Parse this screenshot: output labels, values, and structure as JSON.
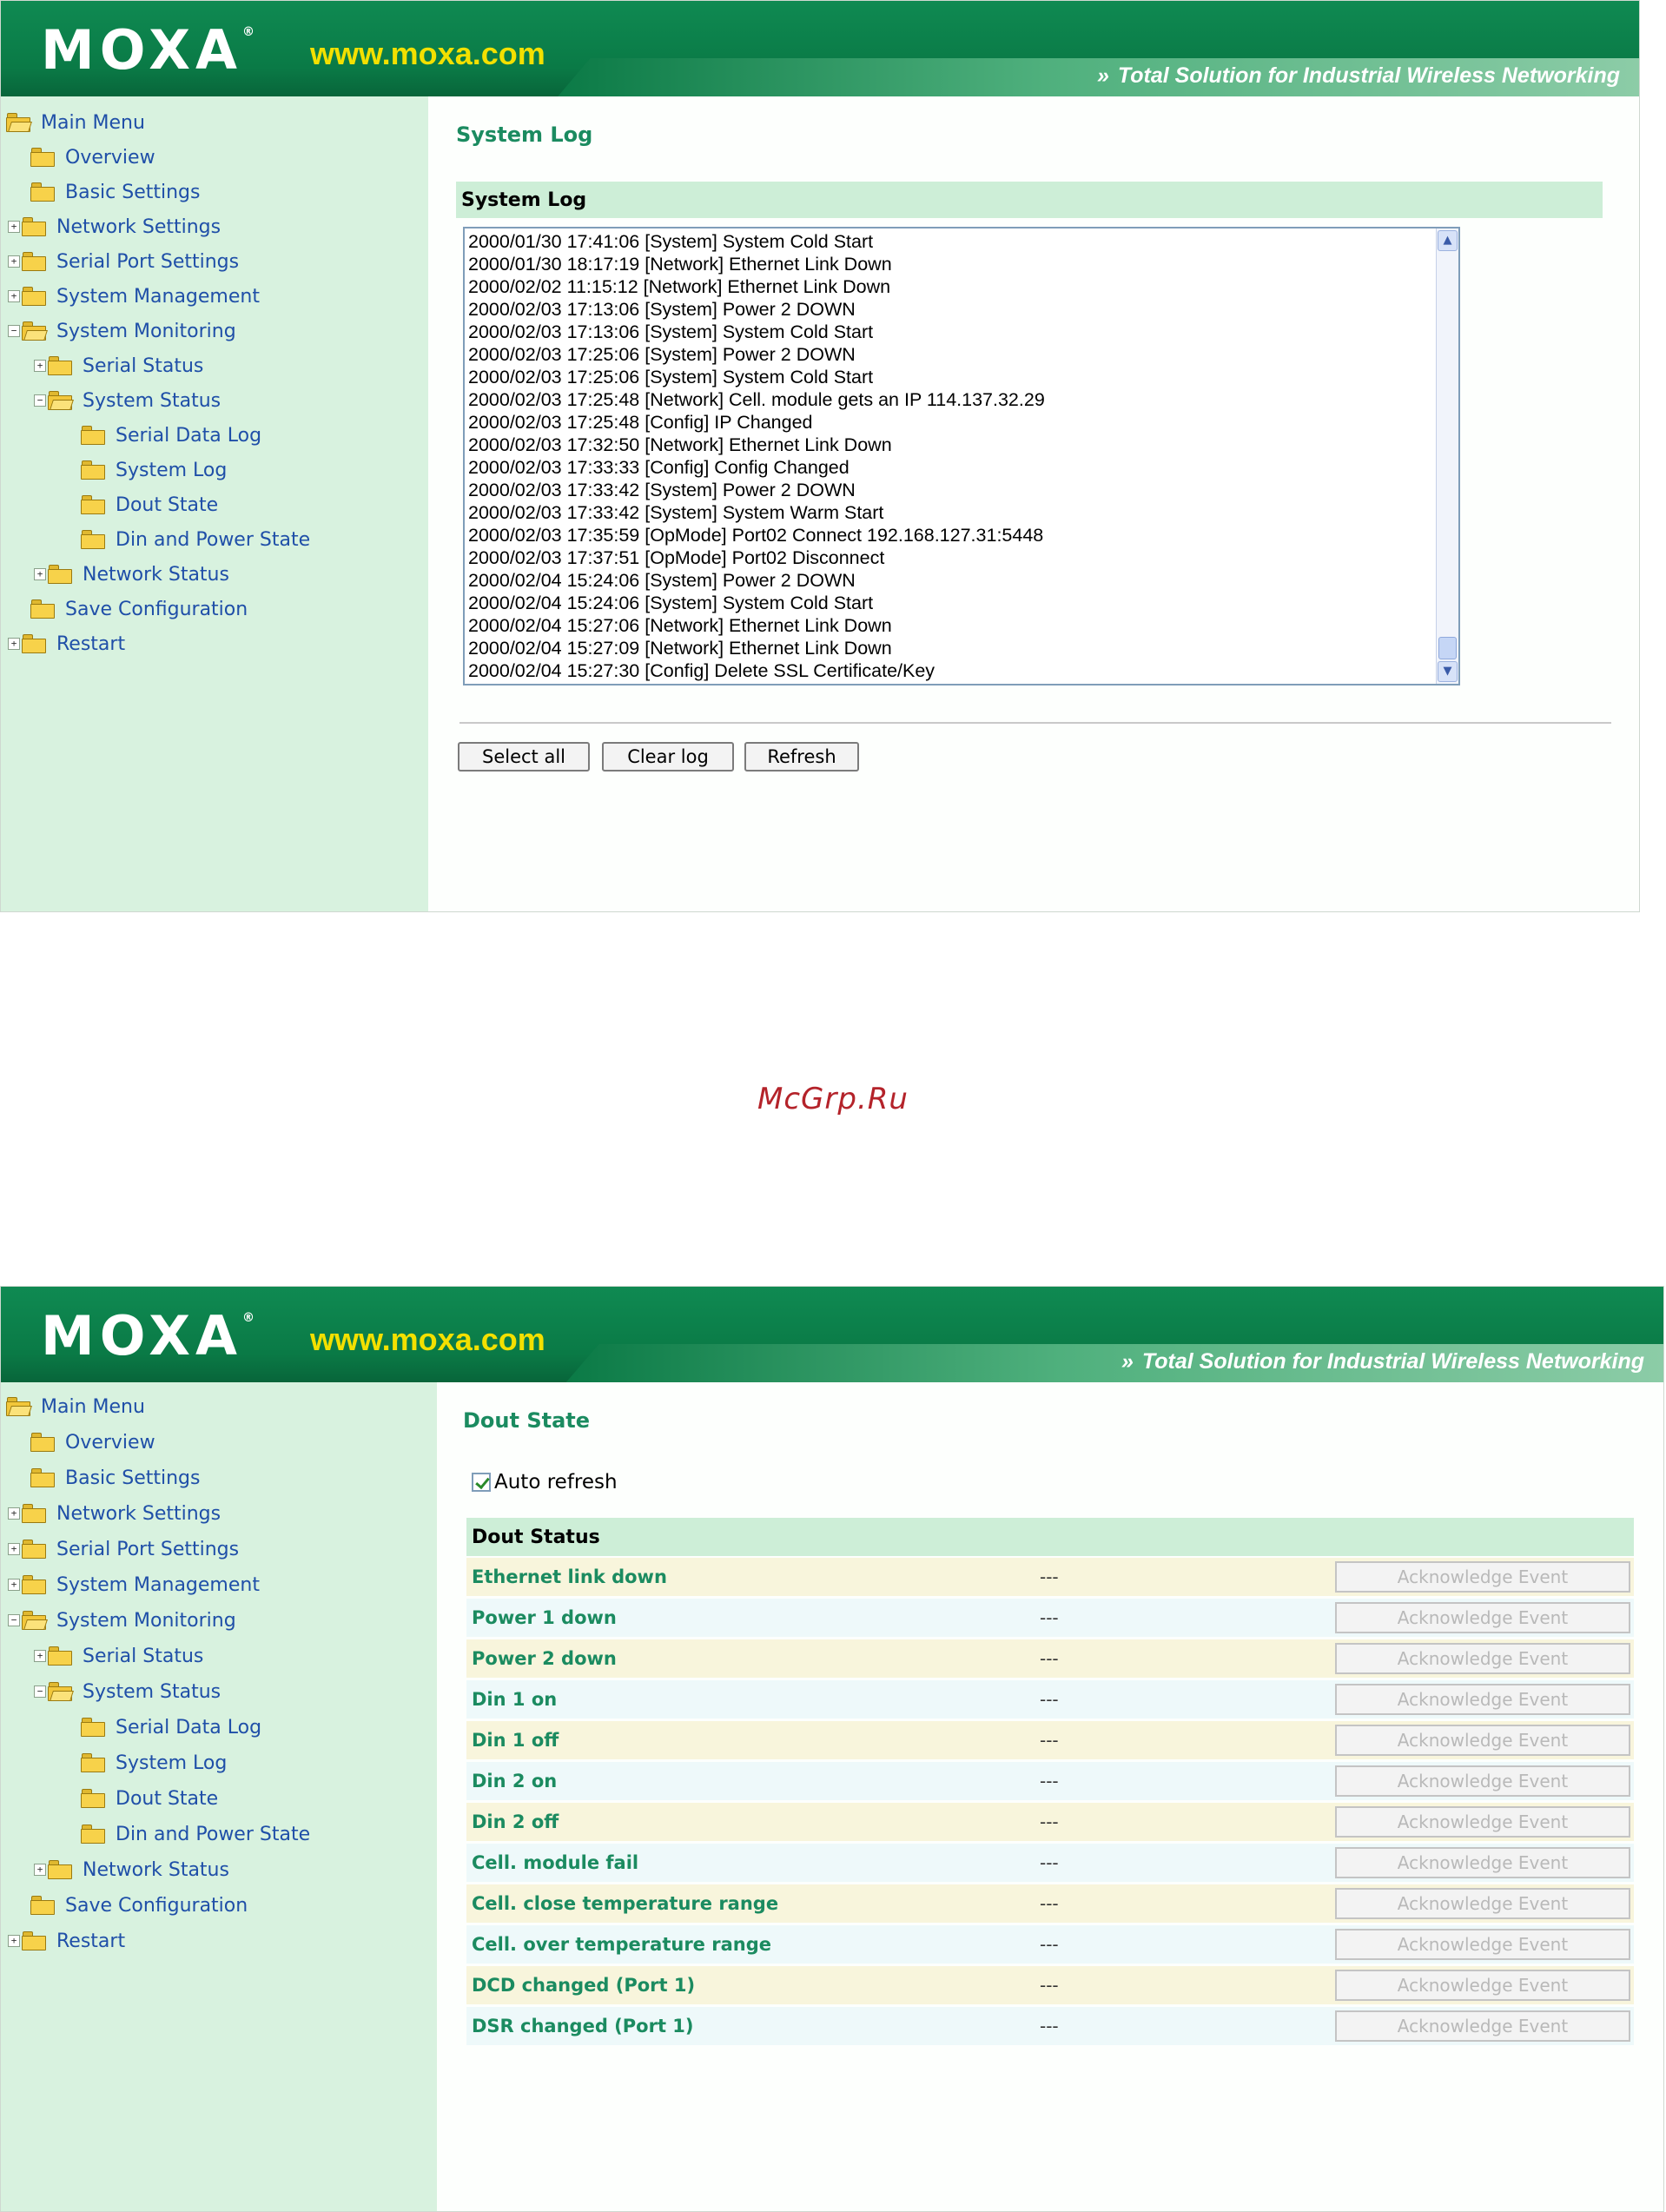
{
  "header": {
    "logo_text": "MOXA",
    "logo_mark": "®",
    "site": "www.moxa.com",
    "tagline_arrows": "»",
    "tagline": "Total Solution for Industrial Wireless Networking"
  },
  "menu": {
    "items": [
      {
        "label": "Main Menu",
        "icon": "folder-open-icon"
      },
      {
        "label": "Overview",
        "icon": "folder-icon"
      },
      {
        "label": "Basic Settings",
        "icon": "folder-icon"
      },
      {
        "label": "Network Settings",
        "icon": "folder-icon"
      },
      {
        "label": "Serial Port Settings",
        "icon": "folder-icon"
      },
      {
        "label": "System Management",
        "icon": "folder-icon"
      },
      {
        "label": "System Monitoring",
        "icon": "folder-open-icon"
      },
      {
        "label": "Serial Status",
        "icon": "folder-icon"
      },
      {
        "label": "System Status",
        "icon": "folder-open-icon"
      },
      {
        "label": "Serial Data Log",
        "icon": "folder-icon"
      },
      {
        "label": "System Log",
        "icon": "folder-icon"
      },
      {
        "label": "Dout State",
        "icon": "folder-icon"
      },
      {
        "label": "Din and Power State",
        "icon": "folder-icon"
      },
      {
        "label": "Network Status",
        "icon": "folder-icon"
      },
      {
        "label": "Save Configuration",
        "icon": "folder-icon"
      },
      {
        "label": "Restart",
        "icon": "folder-icon"
      }
    ],
    "expander_plus": "+",
    "expander_minus": "−"
  },
  "system_log_page": {
    "title": "System Log",
    "section_header": "System Log",
    "log_lines": [
      "2000/01/30 17:41:06 [System] System Cold Start",
      "2000/01/30 18:17:19 [Network] Ethernet Link Down",
      "2000/02/02 11:15:12 [Network] Ethernet Link Down",
      "2000/02/03 17:13:06 [System] Power 2 DOWN",
      "2000/02/03 17:13:06 [System] System Cold Start",
      "2000/02/03 17:25:06 [System] Power 2 DOWN",
      "2000/02/03 17:25:06 [System] System Cold Start",
      "2000/02/03 17:25:48 [Network] Cell. module gets an IP 114.137.32.29",
      "2000/02/03 17:25:48 [Config] IP Changed",
      "2000/02/03 17:32:50 [Network] Ethernet Link Down",
      "2000/02/03 17:33:33 [Config] Config Changed",
      "2000/02/03 17:33:42 [System] Power 2 DOWN",
      "2000/02/03 17:33:42 [System] System Warm Start",
      "2000/02/03 17:35:59 [OpMode] Port02 Connect 192.168.127.31:5448",
      "2000/02/03 17:37:51 [OpMode] Port02 Disconnect",
      "2000/02/04 15:24:06 [System] Power 2 DOWN",
      "2000/02/04 15:24:06 [System] System Cold Start",
      "2000/02/04 15:27:06 [Network] Ethernet Link Down",
      "2000/02/04 15:27:09 [Network] Ethernet Link Down",
      "2000/02/04 15:27:30 [Config] Delete SSL Certificate/Key"
    ],
    "scroll_up": "▲",
    "scroll_down": "▼",
    "buttons": {
      "select_all": "Select all",
      "clear_log": "Clear log",
      "refresh": "Refresh"
    }
  },
  "watermark": "McGrp.Ru",
  "dout_page": {
    "title": "Dout State",
    "auto_refresh_label": "Auto refresh",
    "auto_refresh_checked": true,
    "section_header": "Dout Status",
    "ack_label": "Acknowledge Event",
    "events": [
      {
        "name": "Ethernet link down",
        "value": "---"
      },
      {
        "name": "Power 1 down",
        "value": "---"
      },
      {
        "name": "Power 2 down",
        "value": "---"
      },
      {
        "name": "Din 1 on",
        "value": "---"
      },
      {
        "name": "Din 1 off",
        "value": "---"
      },
      {
        "name": "Din 2 on",
        "value": "---"
      },
      {
        "name": "Din 2 off",
        "value": "---"
      },
      {
        "name": "Cell. module fail",
        "value": "---"
      },
      {
        "name": "Cell. close temperature range",
        "value": "---"
      },
      {
        "name": "Cell. over temperature range",
        "value": "---"
      },
      {
        "name": "DCD changed (Port 1)",
        "value": "---"
      },
      {
        "name": "DSR changed (Port 1)",
        "value": "---"
      }
    ]
  }
}
